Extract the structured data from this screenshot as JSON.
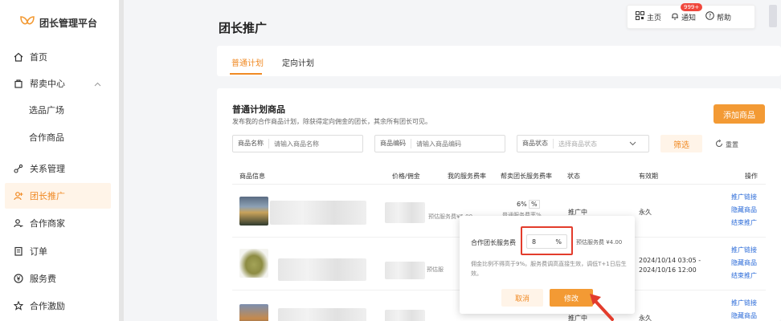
{
  "app": {
    "logo_text": "团长管理平台"
  },
  "sidebar": {
    "items": [
      {
        "label": "首页",
        "icon": "home-icon"
      },
      {
        "label": "帮卖中心",
        "icon": "bag-icon"
      },
      {
        "label": "选品广场"
      },
      {
        "label": "合作商品"
      },
      {
        "label": "关系管理",
        "icon": "relation-icon"
      },
      {
        "label": "团长推广",
        "icon": "promote-icon"
      },
      {
        "label": "合作商家",
        "icon": "merchant-icon"
      },
      {
        "label": "订单",
        "icon": "order-icon"
      },
      {
        "label": "服务费",
        "icon": "fee-icon"
      },
      {
        "label": "合作激励",
        "icon": "incentive-icon"
      }
    ]
  },
  "topbar": {
    "home": "主页",
    "notify": "通知",
    "notify_badge": "999+",
    "help": "帮助"
  },
  "page": {
    "title": "团长推广"
  },
  "tabs": [
    {
      "label": "普通计划"
    },
    {
      "label": "定向计划"
    }
  ],
  "section": {
    "title": "普通计划商品",
    "desc": "发布我的合作商品计划，除获得定向佣金的团长，其余所有团长可见。",
    "add_button": "添加商品"
  },
  "filters": {
    "name_label": "商品名称",
    "name_placeholder": "请输入商品名称",
    "code_label": "商品编码",
    "code_placeholder": "请输入商品编码",
    "status_label": "商品状态",
    "status_placeholder": "选择商品状态",
    "filter_button": "筛选",
    "reset_button": "重置"
  },
  "table": {
    "headers": [
      "商品信息",
      "价格/佣金",
      "我的服务费率",
      "帮卖团长服务费率",
      "状态",
      "有效期",
      "操作"
    ],
    "rows": [
      {
        "rate": "6%",
        "rate_note": "普通服务费率%",
        "est": "预估服务费¥5.00",
        "status": "推广中",
        "validity_1": "永久",
        "validity_2": ""
      },
      {
        "rate": "",
        "rate_note": "",
        "est": "预估服",
        "status": "",
        "validity_1": "2024/10/14 03:05 -",
        "validity_2": "2024/10/16 12:00"
      },
      {
        "rate": "",
        "rate_note": "",
        "est": "",
        "status": "推广中",
        "validity_1": "永久",
        "validity_2": ""
      }
    ],
    "actions": [
      "推广链接",
      "隐藏商品",
      "结束推广"
    ]
  },
  "popover": {
    "label": "合作团长服务费",
    "value": "8",
    "unit": "%",
    "hint": "预估服务费 ¥4.00",
    "note": "佣金比例不得高于9%。服务费调高直接生效，调低T+1日后生效。",
    "cancel": "取消",
    "confirm": "修改"
  },
  "colors": {
    "accent": "#f39a34",
    "link": "#2b6bd8",
    "highlight": "#e33c2c"
  }
}
